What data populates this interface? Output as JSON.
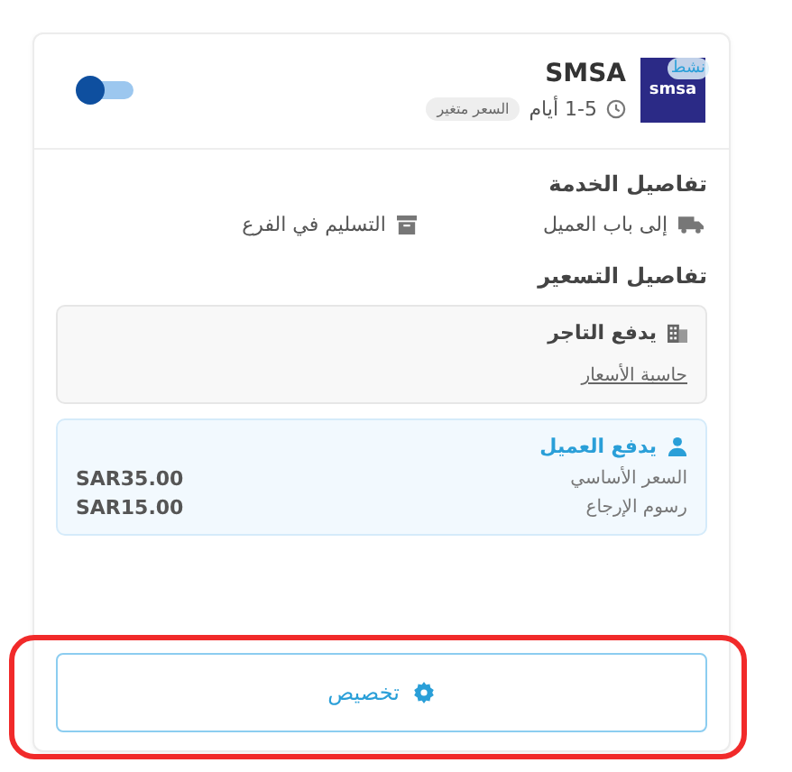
{
  "carrier": {
    "name": "SMSA",
    "logo_text": "smsa",
    "status_badge": "نشط",
    "delivery_time": "1-5 أيام",
    "price_tag": "السعر متغير",
    "enabled": true
  },
  "service_details": {
    "title": "تفاصيل الخدمة",
    "options": [
      {
        "kind": "truck",
        "label": "إلى باب العميل"
      },
      {
        "kind": "box",
        "label": "التسليم في الفرع"
      }
    ]
  },
  "pricing_details": {
    "title": "تفاصيل التسعير",
    "payers": [
      {
        "kind": "merchant",
        "title": "يدفع التاجر",
        "selected": false,
        "link": "حاسبة الأسعار"
      },
      {
        "kind": "customer",
        "title": "يدفع العميل",
        "selected": true,
        "rows": [
          {
            "label": "السعر الأساسي",
            "value": "SAR35.00"
          },
          {
            "label": "رسوم الإرجاع",
            "value": "SAR15.00"
          }
        ]
      }
    ]
  },
  "customize_button": {
    "label": "تخصيص",
    "highlighted": true
  }
}
